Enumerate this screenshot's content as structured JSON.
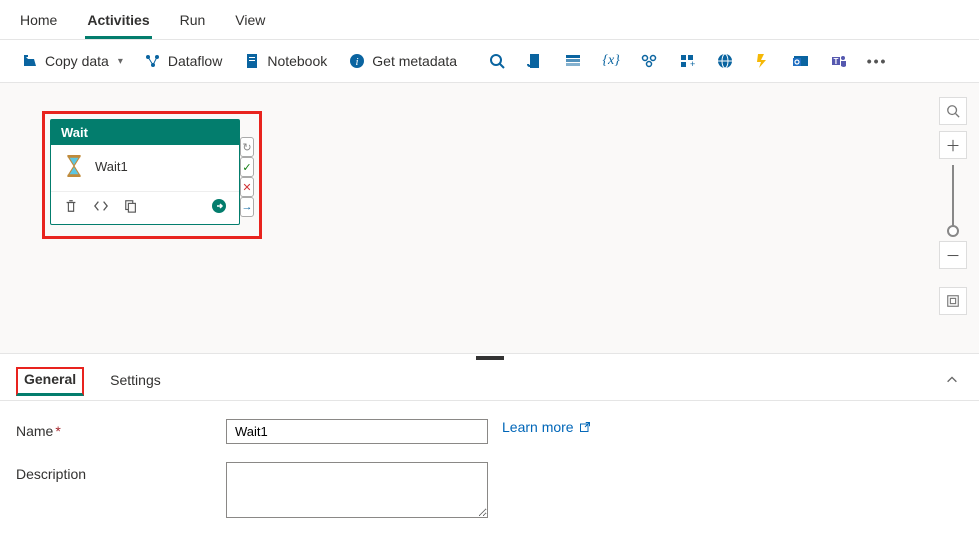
{
  "topTabs": {
    "home": "Home",
    "activities": "Activities",
    "run": "Run",
    "view": "View"
  },
  "toolbar": {
    "copyData": "Copy data",
    "dataflow": "Dataflow",
    "notebook": "Notebook",
    "getMetadata": "Get metadata"
  },
  "activityCard": {
    "type": "Wait",
    "name": "Wait1"
  },
  "bottomTabs": {
    "general": "General",
    "settings": "Settings"
  },
  "form": {
    "nameLabel": "Name",
    "nameValue": "Wait1",
    "descLabel": "Description",
    "descValue": "",
    "learnMore": "Learn more"
  }
}
